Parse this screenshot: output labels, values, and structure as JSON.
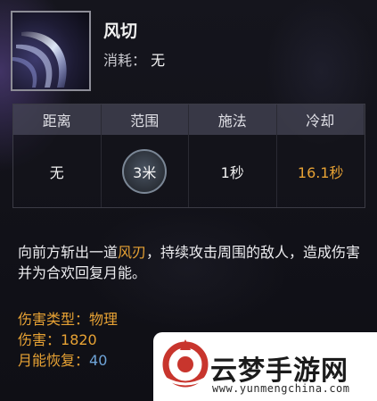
{
  "skill": {
    "name": "风切",
    "cost_label": "消耗：",
    "cost_value": "无",
    "icon": "wind-slash-icon"
  },
  "stats": {
    "headers": [
      "距离",
      "范围",
      "施法",
      "冷却"
    ],
    "values": [
      "无",
      "3米",
      "1秒",
      "16.1秒"
    ]
  },
  "description": {
    "part1": "向前方斩出一道",
    "highlight": "风刃",
    "part2": "，持续攻击周围的敌人，造成伤害并为合欢回复月能。"
  },
  "attributes": [
    {
      "label": "伤害类型：",
      "value": "物理"
    },
    {
      "label": "伤害：",
      "value": "1820"
    },
    {
      "label": "月能恢复：",
      "value": "40"
    }
  ],
  "watermark": {
    "title": "云梦手游网",
    "url": "www.yunmengchina.com",
    "logo": "yunmeng-logo-icon"
  },
  "colors": {
    "accent_orange": "#e7a234",
    "accent_blue": "#6fa4d8",
    "watermark_red": "#c8352d"
  }
}
